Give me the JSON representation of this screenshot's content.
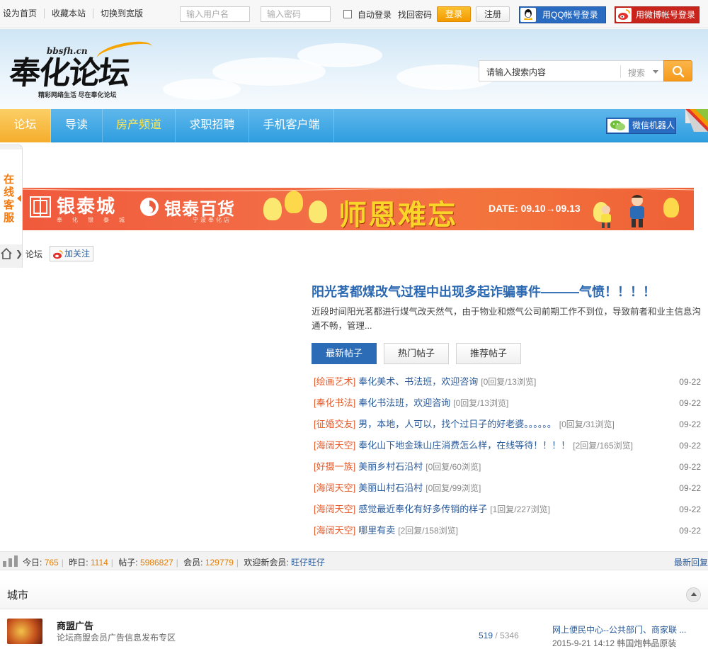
{
  "topbar": {
    "links": [
      "设为首页",
      "收藏本站",
      "切换到宽版"
    ],
    "username_placeholder": "输入用户名",
    "password_placeholder": "输入密码",
    "auto_login": "自动登录",
    "find_password": "找回密码",
    "login": "登录",
    "register": "注册",
    "qq_login": "用QQ帐号登录",
    "weibo_login": "用微博帐号登录"
  },
  "header": {
    "logo_main": "奉化论坛",
    "logo_url": "bbsfh.cn",
    "logo_slogan": "精彩网络生活 尽在奉化论坛",
    "search_placeholder": "请输入搜索内容",
    "search_type": "搜索"
  },
  "nav": {
    "items": [
      "论坛",
      "导读",
      "房产频道",
      "求职招聘",
      "手机客户端"
    ],
    "active_index": 0,
    "wechat_robot": "微信机器人"
  },
  "side_service": "在线客服",
  "banner": {
    "brand1": "银泰城",
    "brand1_sub": "奉化银泰城",
    "brand2": "银泰百货",
    "brand2_sub": "宁波奉化店",
    "slogan": "师恩难忘",
    "date": "DATE: 09.10→09.13"
  },
  "breadcrumb": {
    "home_icon": "home-icon",
    "current": "论坛",
    "follow": "加关注"
  },
  "featured": {
    "title": "阳光茗都煤改气过程中出现多起诈骗事件———气愤！！！！",
    "desc": "近段时间阳光茗都进行煤气改天然气，由于物业和燃气公司前期工作不到位，导致前者和业主信息沟通不畅，管理..."
  },
  "tabs": [
    "最新帖子",
    "热门帖子",
    "推荐帖子"
  ],
  "posts": [
    {
      "cat": "[绘画艺术]",
      "title": "奉化美术、书法班，欢迎咨询",
      "stats": "[0回复/13浏览]",
      "date": "09-22"
    },
    {
      "cat": "[奉化书法]",
      "title": "奉化书法班，欢迎咨询",
      "stats": "[0回复/13浏览]",
      "date": "09-22"
    },
    {
      "cat": "[征婚交友]",
      "title": "男，本地，人可以，找个过日子的好老婆。。。。。。",
      "stats": "[0回复/31浏览]",
      "date": "09-22"
    },
    {
      "cat": "[海阔天空]",
      "title": "奉化山下地金珠山庄消费怎么样，在线等待！！！！",
      "stats": "[2回复/165浏览]",
      "date": "09-22"
    },
    {
      "cat": "[好摄一族]",
      "title": "美丽乡村石沿村",
      "stats": "[0回复/60浏览]",
      "date": "09-22"
    },
    {
      "cat": "[海阔天空]",
      "title": "美丽山村石沿村",
      "stats": "[0回复/99浏览]",
      "date": "09-22"
    },
    {
      "cat": "[海阔天空]",
      "title": "感觉最近奉化有好多传销的样子",
      "stats": "[1回复/227浏览]",
      "date": "09-22"
    },
    {
      "cat": "[海阔天空]",
      "title": "哪里有卖",
      "stats": "[2回复/158浏览]",
      "date": "09-22"
    }
  ],
  "stats": {
    "today_label": "今日:",
    "today": "765",
    "yesterday_label": "昨日:",
    "yesterday": "1114",
    "posts_label": "帖子:",
    "posts": "5986827",
    "members_label": "会员:",
    "members": "129779",
    "welcome_label": "欢迎新会员:",
    "new_member": "旺仔旺仔",
    "latest_reply": "最新回复"
  },
  "city": {
    "label": "城市"
  },
  "forum": {
    "name": "商盟广告",
    "desc": "论坛商盟会员广告信息发布专区",
    "topics": "519",
    "posts_sep": "/",
    "posts": "5346",
    "last_title": "网上便民中心--公共部门、商家联 ...",
    "last_time": "2015-9-21 14:12 韩国炮韩品原装"
  },
  "colors": {
    "nav_blue": "#2f9ee0",
    "nav_active": "#f5ad2c",
    "link_blue": "#2b5b9a",
    "category_orange": "#e55b2a",
    "stat_orange": "#e67e00"
  }
}
